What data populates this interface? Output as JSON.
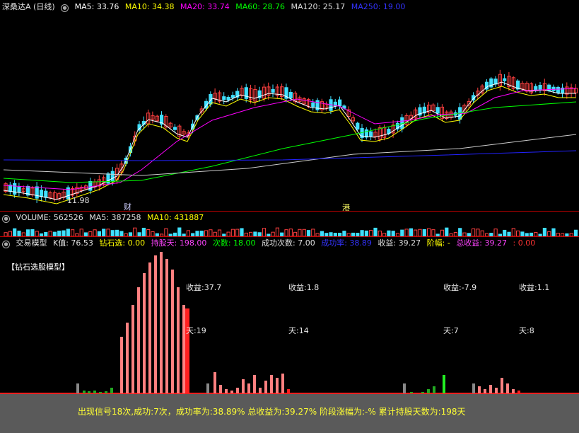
{
  "header": {
    "title": "深桑达A (日线)",
    "ma5": {
      "label": "MA5: 33.76",
      "color": "#ffffff"
    },
    "ma10": {
      "label": "MA10: 34.38",
      "color": "#ffff00"
    },
    "ma20": {
      "label": "MA20: 33.74",
      "color": "#ff00ff"
    },
    "ma60": {
      "label": "MA60: 28.76",
      "color": "#00ff00"
    },
    "ma120": {
      "label": "MA120: 25.17",
      "color": "#dddddd"
    },
    "ma250": {
      "label": "MA250: 19.00",
      "color": "#3333ff"
    }
  },
  "price_chart": {
    "low_label": "11.98",
    "marker_cai": "财",
    "marker_hk": "港"
  },
  "volume": {
    "label": "VOLUME: 562526",
    "ma5": "MA5: 387258",
    "ma10": "MA10: 431887"
  },
  "indicator": {
    "name": "交易模型",
    "k": "K值: 76.53",
    "zs": "钻石选: 0.00",
    "days": "持股天: 198.00",
    "count": "次数: 18.00",
    "success": "成功次数: 7.00",
    "rate": "成功率: 38.89",
    "gain": "收益: 39.27",
    "stage": "阶幅: -",
    "total": "总收益: 39.27",
    "zero": ": 0.00",
    "model_title": "【钻石选股模型】",
    "annotations": [
      {
        "gain": "收益:37.7",
        "days": "天:19"
      },
      {
        "gain": "收益:1.8",
        "days": "天:14"
      },
      {
        "gain": "收益:-7.9",
        "days": "天:7"
      },
      {
        "gain": "收益:1.1",
        "days": "天:8"
      }
    ]
  },
  "footer": {
    "summary": "出现信号18次,成功:7次，成功率为:38.89% 总收益为:39.27% 阶段涨幅为:-% 累计持股天数为:198天"
  }
}
